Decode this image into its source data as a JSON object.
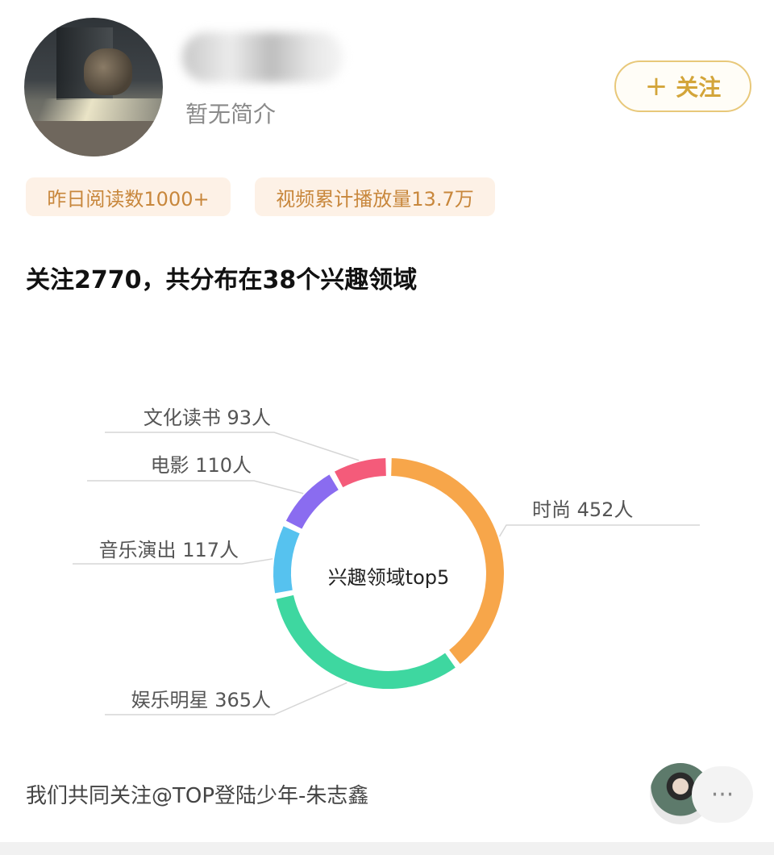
{
  "profile": {
    "bio": "暂无简介",
    "follow_button": "关注",
    "follow_icon": "plus-icon"
  },
  "stats": {
    "yesterday_reads": "昨日阅读数1000+",
    "video_plays": "视频累计播放量13.7万"
  },
  "follow_summary": "关注2770，共分布在38个兴趣领域",
  "chart_data": {
    "type": "pie",
    "title": "兴趣领域top5",
    "slices": [
      {
        "label": "时尚 452人",
        "name": "时尚",
        "value": 452,
        "color": "#f7a64a"
      },
      {
        "label": "娱乐明星 365人",
        "name": "娱乐明星",
        "value": 365,
        "color": "#3ed7a0"
      },
      {
        "label": "音乐演出 117人",
        "name": "音乐演出",
        "value": 117,
        "color": "#56c2ef"
      },
      {
        "label": "电影 110人",
        "name": "电影",
        "value": 110,
        "color": "#8a6cf0"
      },
      {
        "label": "文化读书 93人",
        "name": "文化读书",
        "value": 93,
        "color": "#f45b7a"
      }
    ]
  },
  "mutual_follow": "我们共同关注@TOP登陆少年-朱志鑫",
  "more_icon": "more-dots-icon"
}
